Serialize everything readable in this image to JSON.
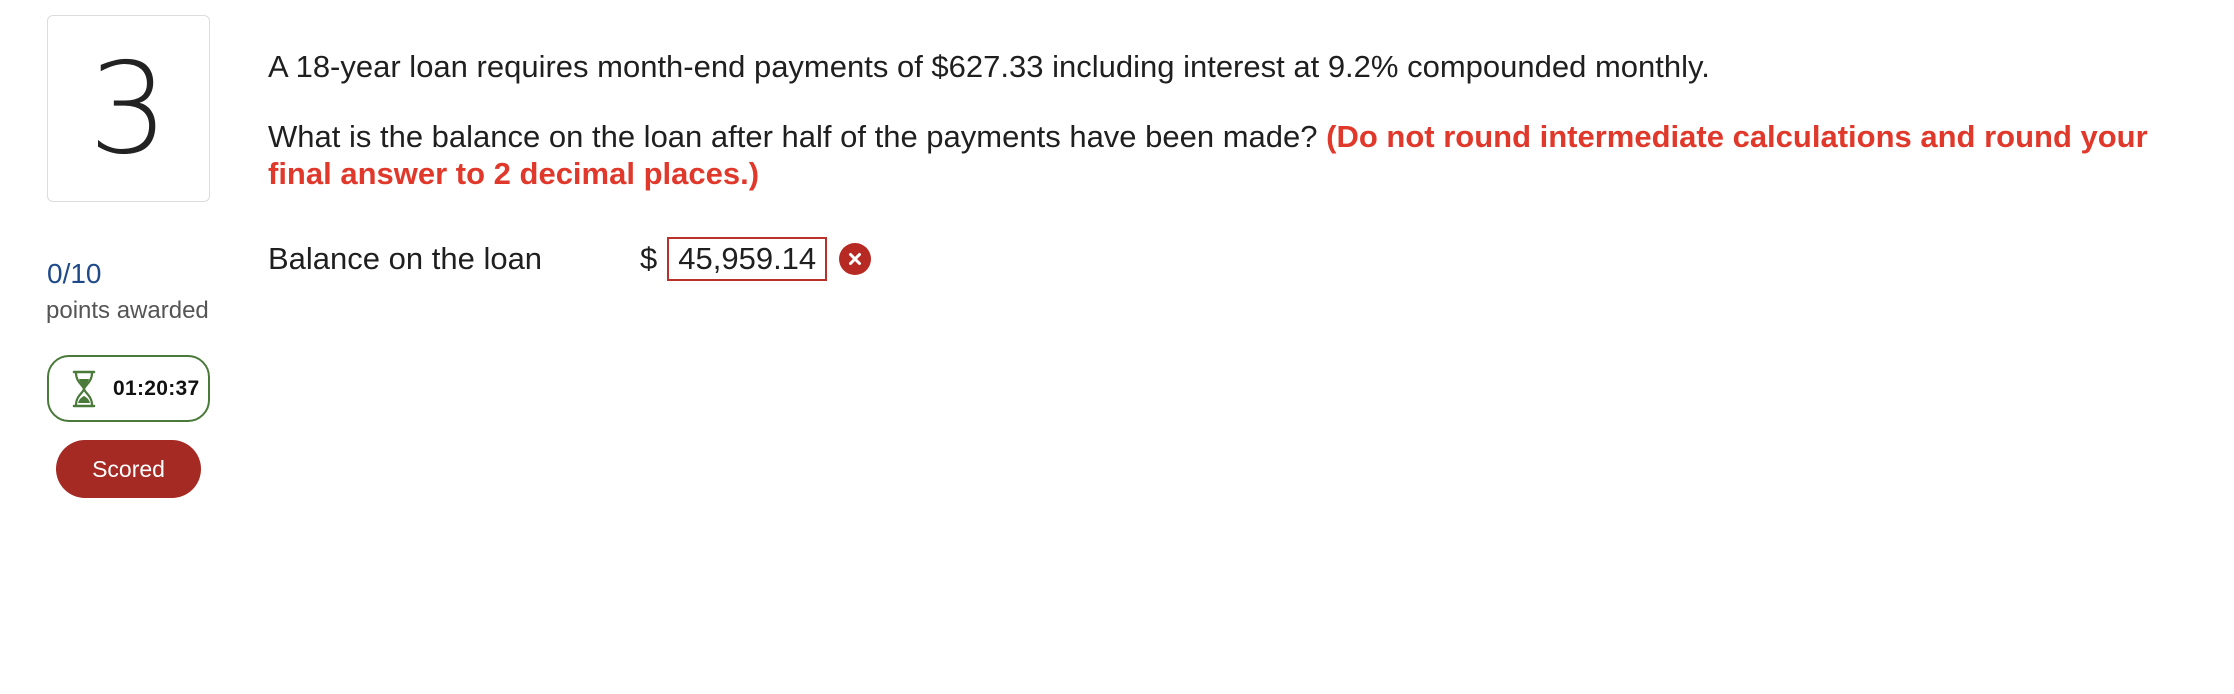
{
  "question": {
    "number": "3",
    "text": "A 18-year loan requires month-end payments of $627.33 including interest at 9.2% compounded monthly.",
    "prompt": "What is the balance on the loan after half of the payments have been made? ",
    "instruction": "(Do not round intermediate calculations and round your final answer to 2 decimal places.)"
  },
  "score": {
    "value": "0/10",
    "label": "points awarded"
  },
  "timer": {
    "time": "01:20:37",
    "icon": "hourglass-icon"
  },
  "status": {
    "label": "Scored",
    "color": "#a52a24"
  },
  "answer": {
    "label": "Balance on the loan",
    "currency": "$",
    "value": "45,959.14",
    "result_icon": "incorrect-icon"
  },
  "colors": {
    "accent_red": "#e0382a",
    "score_blue": "#1f4a8a",
    "timer_green": "#4a7a3a"
  }
}
